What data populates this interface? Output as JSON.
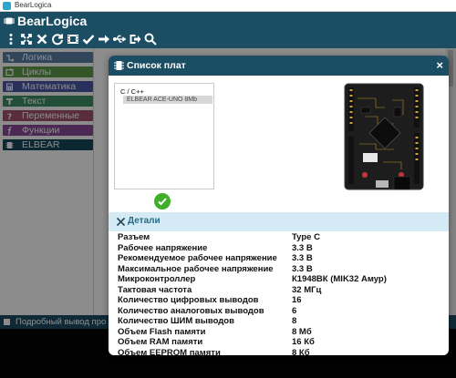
{
  "window": {
    "title": "BearLogica"
  },
  "app": {
    "name": "BearLogica"
  },
  "toolbar": {
    "buttons": [
      {
        "icon": "kebab-menu-icon"
      },
      {
        "icon": "fullscreen-icon"
      },
      {
        "icon": "close-icon"
      },
      {
        "icon": "refresh-icon"
      },
      {
        "icon": "board-film-icon"
      },
      {
        "icon": "checkmark-icon"
      },
      {
        "icon": "upload-arrow-icon"
      },
      {
        "icon": "usb-icon"
      },
      {
        "icon": "sign-out-icon"
      },
      {
        "icon": "search-icon"
      }
    ]
  },
  "categories": [
    {
      "label": "Логика",
      "color": "#5a7fa6",
      "icon": "logic-icon"
    },
    {
      "label": "Циклы",
      "color": "#5e9b4a",
      "icon": "loop-icon"
    },
    {
      "label": "Математика",
      "color": "#4b58a8",
      "icon": "calculator-icon"
    },
    {
      "label": "Текст",
      "color": "#3f8f66",
      "icon": "text-icon"
    },
    {
      "label": "Переменные",
      "color": "#a35372",
      "icon": "question-icon"
    },
    {
      "label": "Функции",
      "color": "#8a4a9a",
      "icon": "function-icon"
    },
    {
      "label": "ELBEAR",
      "color": "#14475c",
      "icon": "chip-icon"
    }
  ],
  "output": {
    "label": "Подробный вывод про"
  },
  "modal": {
    "title": "Список плат",
    "close_label": "×",
    "board_group": "C / C++",
    "board_selected": "ELBEAR ACE-UNO 8Mb",
    "details_title": "Детали",
    "specs": [
      {
        "key": "Разъем",
        "value": "Type C"
      },
      {
        "key": "Рабочее напряжение",
        "value": "3.3 В"
      },
      {
        "key": "Рекомендуемое рабочее напряжение",
        "value": "3.3 В"
      },
      {
        "key": "Максимальное рабочее напряжение",
        "value": "3.3 В"
      },
      {
        "key": "Микроконтроллер",
        "value": "К1948ВК (MIK32 Амур)"
      },
      {
        "key": "Тактовая частота",
        "value": "32 МГц"
      },
      {
        "key": "Количество цифровых выводов",
        "value": "16"
      },
      {
        "key": "Количество аналоговых выводов",
        "value": "6"
      },
      {
        "key": "Количество ШИМ выводов",
        "value": "8"
      },
      {
        "key": "Объем Flash памяти",
        "value": "8 Мб"
      },
      {
        "key": "Объем RAM памяти",
        "value": "16 Кб"
      },
      {
        "key": "Объем EEPROM памяти",
        "value": "8 Кб"
      }
    ]
  },
  "colors": {
    "header": "#1c4e63",
    "details_bg": "#d4ebf5",
    "ok_green": "#3fae2a"
  }
}
